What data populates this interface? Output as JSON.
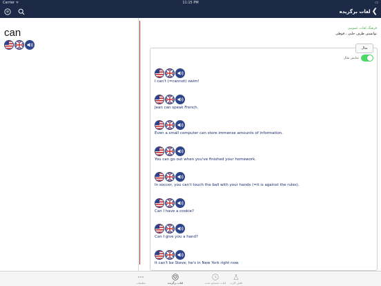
{
  "status_bar": {
    "carrier": "Carrier ᯤ",
    "time": "11:15 PM",
    "battery": "▭"
  },
  "nav": {
    "title": "لغات برگزیده",
    "back_glyph": "❮"
  },
  "entry": {
    "word": "can"
  },
  "dictionary": {
    "name": "فرهنگ لغات عمومی",
    "meaning": "توانستن ظرف حلبی ، قوطی"
  },
  "examples_tab": {
    "label": "مثال"
  },
  "show_examples": {
    "label": "نمایش مثال",
    "on": true
  },
  "examples": [
    {
      "text": "I can't (=cannot) swim!"
    },
    {
      "text": "Jean can speak French."
    },
    {
      "text": "Even a small computer can store immense amounts of information."
    },
    {
      "text": "You can go out when you've finished your homework."
    },
    {
      "text": "In soccer, you can't touch the ball with your hands (=it is against the rules)."
    },
    {
      "text": "Can I have a cookie?"
    },
    {
      "text": "Can I give you a hand?"
    },
    {
      "text": "It can't be Steve; he's in New York right now."
    }
  ],
  "tabs": [
    {
      "label": "تنظیمات",
      "icon": "more-icon",
      "active": false
    },
    {
      "label": "لغات برگزیده",
      "icon": "heart-icon",
      "active": true
    },
    {
      "label": "لغات جستجو شده",
      "icon": "history-icon",
      "active": false
    },
    {
      "label": "فلش کارت",
      "icon": "flask-icon",
      "active": false
    }
  ],
  "colors": {
    "nav_bg": "#1c2a47",
    "accent_green": "#4caf50",
    "separator_red": "#c62828",
    "example_text": "#1a2a6e"
  }
}
